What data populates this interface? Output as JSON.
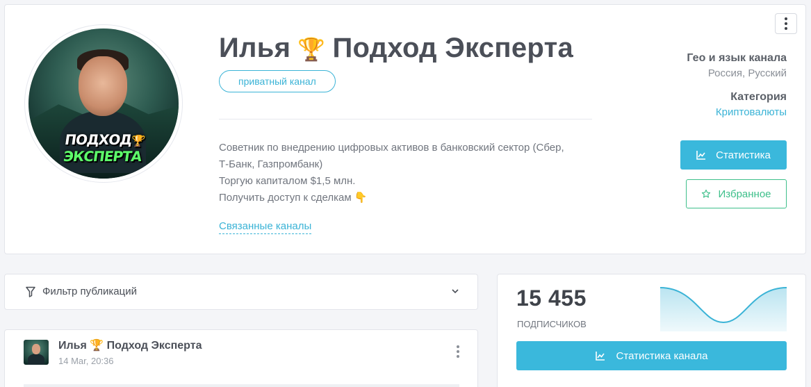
{
  "channel": {
    "name": "Илья",
    "trophy_icon": "🏆",
    "name_suffix": "Подход Эксперта",
    "privacy_badge": "приватный канал",
    "avatar_text_white": "ПОДХОД",
    "avatar_text_green": "ЭКСПЕРТА",
    "description_lines": [
      "Советник по внедрению цифровых активов в банковский сектор (Сбер,",
      "Т-Банк, Газпромбанк)",
      "Торгую капиталом $1,5 млн.",
      "Получить доступ к сделкам 👇"
    ],
    "related_link": "Связанные каналы"
  },
  "meta": {
    "geo_label": "Гео и язык канала",
    "geo_value": "Россия, Русский",
    "category_label": "Категория",
    "category_value": "Криптовалюты"
  },
  "actions": {
    "stats_button": "Статистика",
    "favorites_button": "Избранное"
  },
  "filter": {
    "label": "Фильтр публикаций"
  },
  "post": {
    "title": "Илья 🏆 Подход Эксперта",
    "date": "14 Mar, 20:36"
  },
  "subscribers": {
    "count": "15 455",
    "label": "ПОДПИСЧИКОВ",
    "channel_stats_button": "Статистика канала"
  },
  "colors": {
    "accent_blue": "#3ab8dc",
    "accent_green": "#3dbf8a",
    "sparkline_stroke": "#3ab3d6"
  }
}
